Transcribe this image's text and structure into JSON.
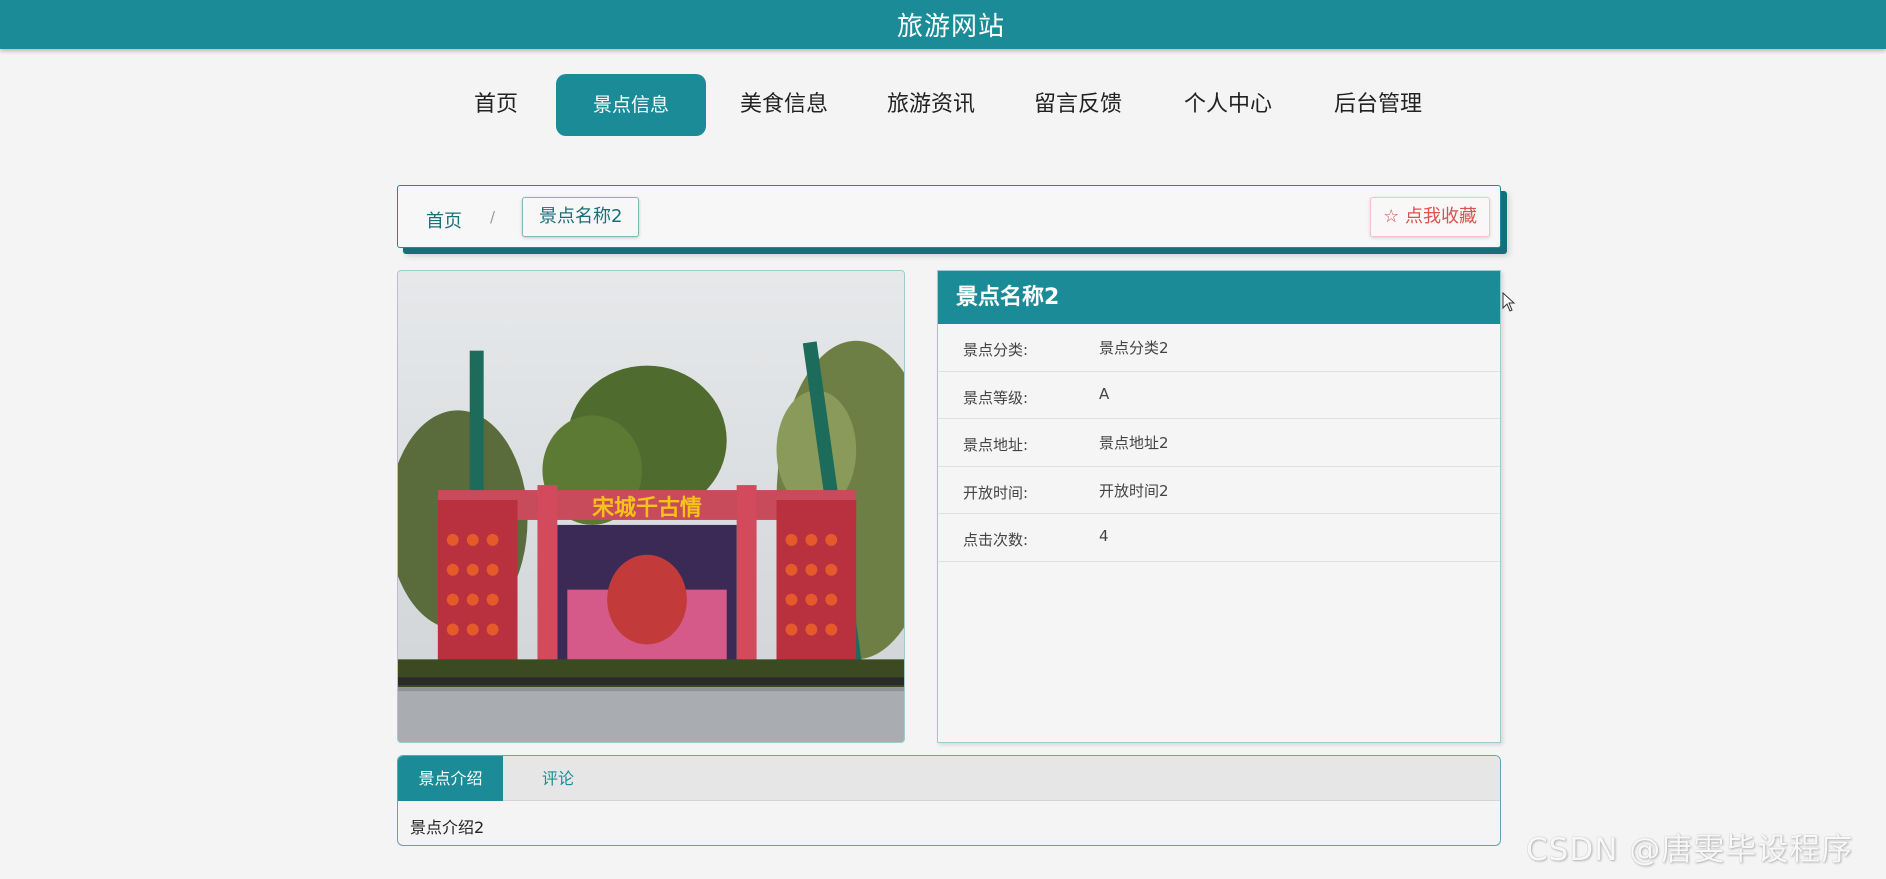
{
  "header": {
    "site_title": "旅游网站"
  },
  "nav": {
    "items": [
      {
        "label": "首页"
      },
      {
        "label": "景点信息",
        "active": true
      },
      {
        "label": "美食信息"
      },
      {
        "label": "旅游资讯"
      },
      {
        "label": "留言反馈"
      },
      {
        "label": "个人中心"
      },
      {
        "label": "后台管理"
      }
    ]
  },
  "breadcrumb": {
    "home": "首页",
    "separator": "/",
    "current": "景点名称2",
    "favorite_label": "☆ 点我收藏"
  },
  "photo": {
    "banner_text": "宋城千古情",
    "icon": "scenic-photo"
  },
  "details": {
    "name": "景点名称2",
    "rows": [
      {
        "label": "景点分类:",
        "value": "景点分类2"
      },
      {
        "label": "景点等级:",
        "value": "A"
      },
      {
        "label": "景点地址:",
        "value": "景点地址2"
      },
      {
        "label": "开放时间:",
        "value": "开放时间2"
      },
      {
        "label": "点击次数:",
        "value": "4"
      }
    ]
  },
  "tabs": {
    "items": [
      {
        "label": "景点介绍",
        "active": true
      },
      {
        "label": "评论"
      }
    ],
    "content": "景点介绍2"
  },
  "watermark": "CSDN @唐雯毕设程序",
  "colors": {
    "primary": "#1b8c97",
    "favorite": "#d9534f",
    "background": "#f4f4f4"
  }
}
